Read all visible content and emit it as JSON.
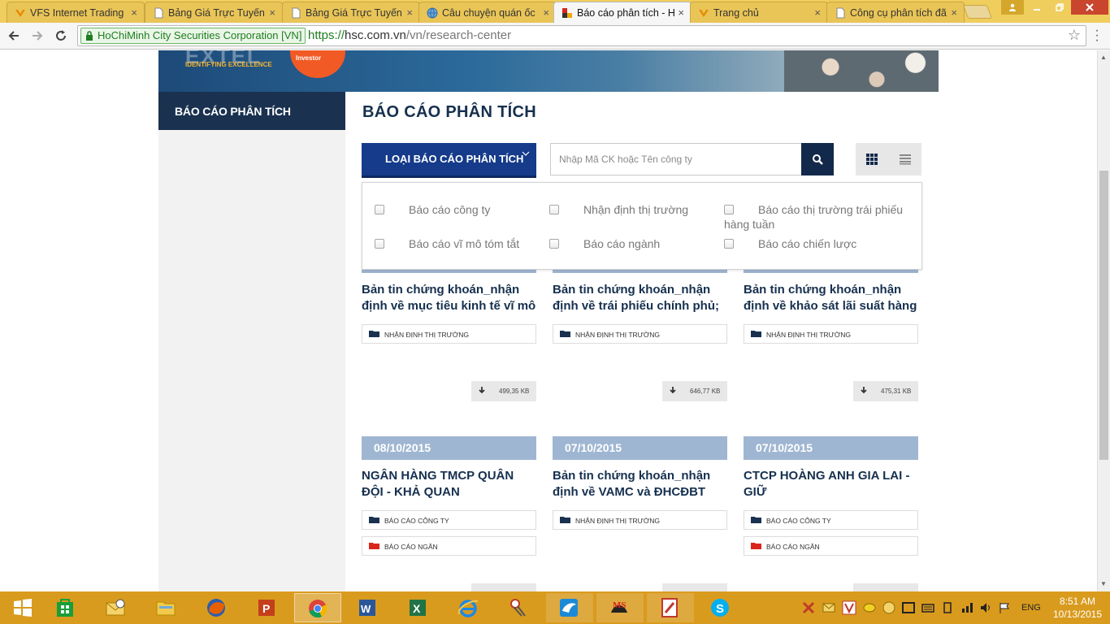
{
  "browser": {
    "tabs": [
      {
        "title": "VFS Internet Trading",
        "icon": "vfs-logo-icon"
      },
      {
        "title": "Bảng Giá Trực Tuyến",
        "icon": "page-icon"
      },
      {
        "title": "Bảng Giá Trực Tuyến",
        "icon": "page-icon"
      },
      {
        "title": "Câu chuyện quán ốc",
        "icon": "globe-icon"
      },
      {
        "title": "Báo cáo phân tích - H",
        "icon": "hsc-logo-icon"
      },
      {
        "title": "Trang chủ",
        "icon": "vfs-logo-icon"
      },
      {
        "title": "Công cụ phân tích đã",
        "icon": "page-icon"
      }
    ],
    "close_glyph": "×",
    "ev_cert": "HoChiMinh City Securities Corporation [VN]",
    "url_scheme": "https://",
    "url_host": "hsc.com.vn",
    "url_path": "/vn/research-center"
  },
  "banner": {
    "extel_text": "EXTEL",
    "extel_tagline": "IDENTIFYING EXCELLENCE",
    "badge_text": "Investor"
  },
  "sidebar": {
    "active_item": "BÁO CÁO PHÂN TÍCH"
  },
  "main": {
    "page_title": "BÁO CÁO PHÂN TÍCH",
    "type_button": "LOẠI BÁO CÁO PHÂN TÍCH",
    "search_placeholder": "Nhập Mã CK hoặc Tên công ty",
    "filter_options": [
      "Báo cáo công ty",
      "Nhận định thị trường",
      "Báo cáo thị trường trái phiếu",
      "hàng tuần",
      "Báo cáo vĩ mô tóm tắt",
      "Báo cáo ngành",
      "Báo cáo chiến lược"
    ],
    "cards": [
      {
        "title": "Bản tin chứng khoán_nhận định về mục tiêu kinh tế vĩ mô",
        "tags": [
          "NHẬN ĐỊNH THỊ TRƯỜNG"
        ],
        "size": "499,35 KB"
      },
      {
        "title": "Bản tin chứng khoán_nhận định về trái phiếu chính phủ;",
        "tags": [
          "NHẬN ĐỊNH THỊ TRƯỜNG"
        ],
        "size": "646,77 KB"
      },
      {
        "title": "Bản tin chứng khoán_nhận định về khảo sát lãi suất hàng",
        "tags": [
          "NHẬN ĐỊNH THỊ TRƯỜNG"
        ],
        "size": "475,31 KB"
      },
      {
        "date": "08/10/2015",
        "title": "NGÂN HÀNG TMCP QUÂN ĐỘI - KHẢ QUAN",
        "tags": [
          "BÁO CÁO CÔNG TY",
          "BÁO CÁO NGÂN"
        ]
      },
      {
        "date": "07/10/2015",
        "title": "Bản tin chứng khoán_nhận định về VAMC và ĐHCĐBT",
        "tags": [
          "NHẬN ĐỊNH THỊ TRƯỜNG"
        ]
      },
      {
        "date": "07/10/2015",
        "title": "CTCP HOÀNG ANH GIA LAI - GIỮ",
        "tags": [
          "BÁO CÁO CÔNG TY",
          "BÁO CÁO NGÂN"
        ]
      }
    ]
  },
  "taskbar": {
    "language": "ENG",
    "time": "8:51 AM",
    "date": "10/13/2015"
  },
  "colors": {
    "tabbar": "#f0ce5d",
    "navy": "#16304f",
    "type_button": "#153b8a",
    "date_header": "#9fb6d2",
    "folder_navy": "#1a3150",
    "folder_red": "#d9251c",
    "taskbar": "#d99b1e"
  }
}
